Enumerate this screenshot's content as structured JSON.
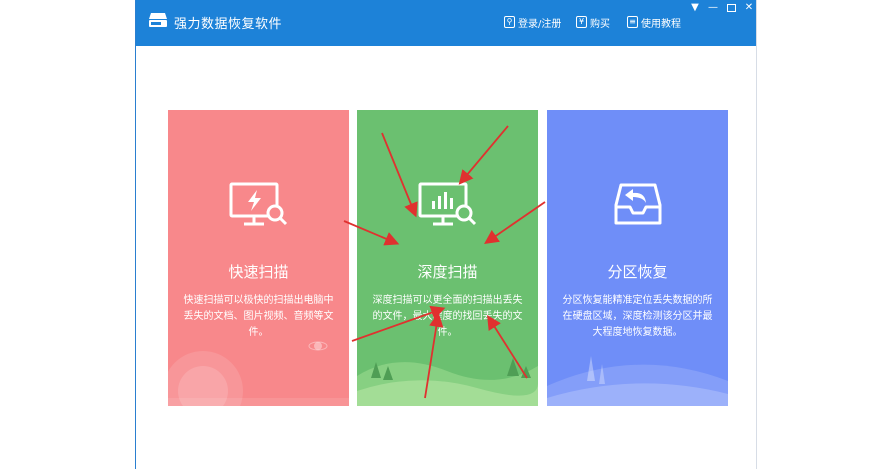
{
  "window": {
    "title": "强力数据恢复软件",
    "toolbar": {
      "login_label": "登录/注册",
      "buy_label": "购买",
      "guide_label": "使用教程"
    },
    "controls": {
      "menu": "▼",
      "minimize": "—",
      "close": "✕"
    }
  },
  "colors": {
    "titlebar": "#1d82d8",
    "card_red": "#f8888b",
    "card_green": "#6bc070",
    "card_blue": "#6f8ef8",
    "arrow": "#e0312f"
  },
  "cards": [
    {
      "icon": "monitor-lightning-search-icon",
      "title": "快速扫描",
      "desc": "快速扫描可以极快的扫描出电脑中丢失的文档、图片视频、音频等文件。"
    },
    {
      "icon": "monitor-chart-search-icon",
      "title": "深度扫描",
      "desc": "深度扫描可以更全面的扫描出丢失的文件，最大程度的找回丢失的文件。"
    },
    {
      "icon": "inbox-return-icon",
      "title": "分区恢复",
      "desc": "分区恢复能精准定位丢失数据的所在硬盘区域，深度检测该分区并最大程度地恢复数据。"
    }
  ]
}
